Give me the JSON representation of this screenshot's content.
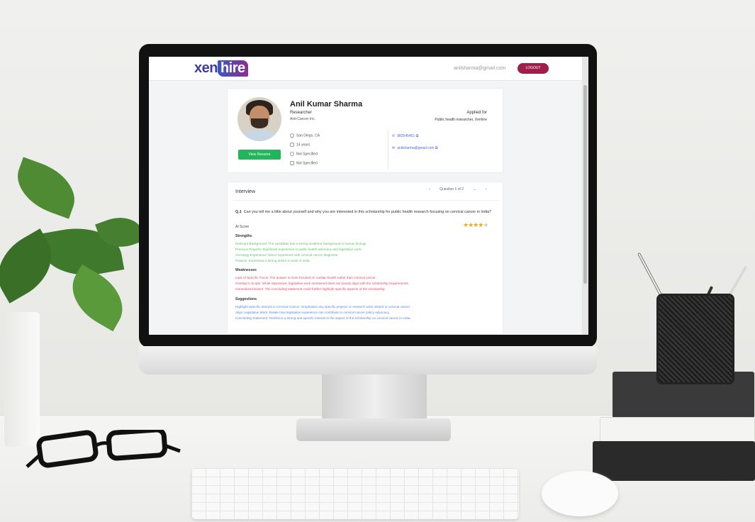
{
  "header": {
    "logo_left": "xen",
    "logo_right": "hire",
    "user_email": "anilsharma@gmail.com",
    "logout_label": "LOGOUT"
  },
  "profile": {
    "name": "Anil Kumar Sharma",
    "role": "Researcher",
    "company": "Anti-Cancer Inc.",
    "applied_label": "Applied for",
    "applied_position": "Public health researcher, Xenhire",
    "location": "San Diego, CA",
    "experience": "14 years",
    "field_3": "Not Specified",
    "field_4": "Not Specified",
    "phone": "982545451",
    "contact_email": "anilsharma@gmail.com",
    "view_resume_label": "View Resume"
  },
  "interview": {
    "title": "Interview",
    "prev_symbol": "‹",
    "question_counter": "Question 1 of 2",
    "dropdown_symbol": "⌄",
    "next_symbol": "›",
    "question_label": "Q.1",
    "question_text": "Can you tell me a little about yourself and why you are interested in this scholarship for public health research focusing on cervical cancer in India?",
    "ai_score_label": "AI Score",
    "rating": 4,
    "rating_max": 5,
    "strengths_label": "Strengths",
    "strengths": [
      "Relevant Background: The candidate has a strong academic background in human biology.",
      "Previous Projects: Significant experience in public health advocacy and legislative work.",
      "Oncology Experience: Direct experience with cervical cancer diagnosis.",
      "Passion: Expressed a strong desire to work in India."
    ],
    "weaknesses_label": "Weaknesses",
    "weaknesses": [
      "Lack of Specific Focus: The answer is more focused on cardiac health rather than cervical cancer.",
      "Overlap in Scope: While impressive, legislative work mentioned does not closely align with the scholarship requirements.",
      "Generalized Desire: The concluding statement could further highlight specific aspects of the scholarship."
    ],
    "suggestions_label": "Suggestions",
    "suggestions": [
      "Highlight Specific Interest in Cervical Cancer: Emphasize any specific projects or research work related to cervical cancer.",
      "Align Legislative Work: Relate how legislative experience can contribute to cervical cancer policy advocacy.",
      "Concluding Statement: Reinforce a strong and specific interest in the aspect of the scholarship on cervical cancer in India."
    ]
  },
  "colors": {
    "brand": "#9e1f4b",
    "resume_button": "#22b55b",
    "strength_text": "#5fbf6a",
    "weakness_text": "#e2476a",
    "suggestion_text": "#5b84e0",
    "star": "#f2a81d"
  }
}
